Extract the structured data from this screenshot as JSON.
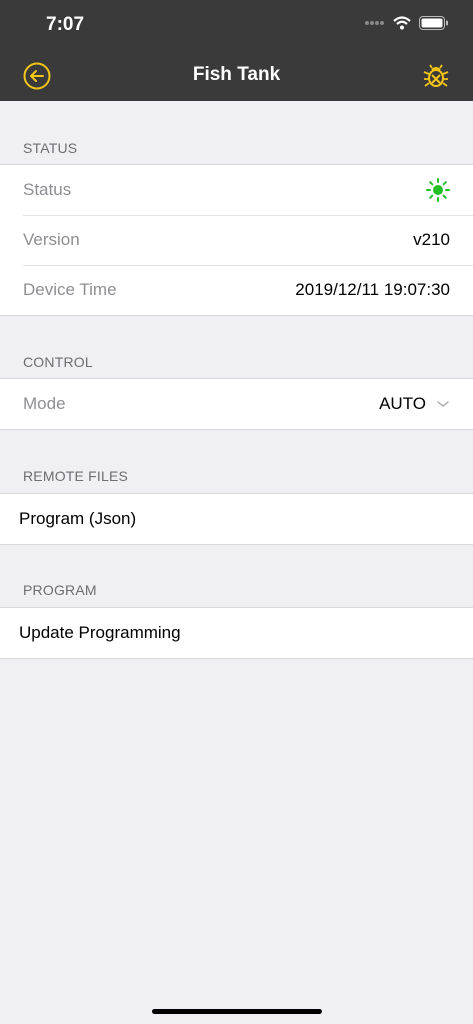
{
  "status_bar": {
    "time": "7:07"
  },
  "nav": {
    "title": "Fish Tank",
    "accent_color": "#f5c518"
  },
  "sections": {
    "status": {
      "header": "STATUS",
      "rows": [
        {
          "label": "Status",
          "icon": "sun-icon",
          "icon_color": "#22c022"
        },
        {
          "label": "Version",
          "value": "v210"
        },
        {
          "label": "Device Time",
          "value": "2019/12/11 19:07:30"
        }
      ]
    },
    "control": {
      "header": "CONTROL",
      "rows": [
        {
          "label": "Mode",
          "value": "AUTO"
        }
      ]
    },
    "remote_files": {
      "header": "REMOTE FILES",
      "rows": [
        {
          "label": "Program (Json)"
        }
      ]
    },
    "program": {
      "header": "PROGRAM",
      "rows": [
        {
          "label": "Update Programming"
        }
      ]
    }
  }
}
